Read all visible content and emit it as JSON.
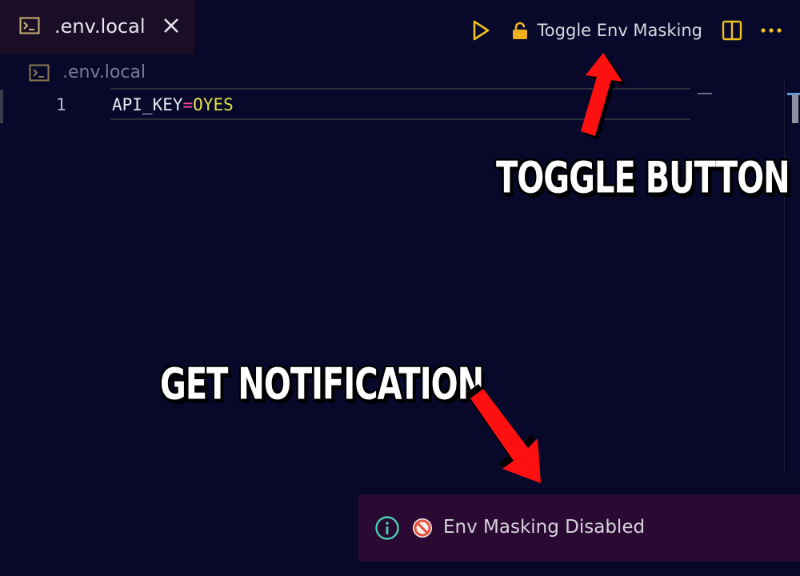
{
  "tab": {
    "title": ".env.local",
    "icon": "terminal-file-icon",
    "close_icon": "close-icon"
  },
  "actions": {
    "run_icon": "play-icon",
    "toggle_icon": "lock-icon",
    "toggle_label": "Toggle Env Masking",
    "split_icon": "split-editor-icon",
    "more_icon": "more-icon"
  },
  "breadcrumb": {
    "icon": "terminal-file-icon",
    "label": ".env.local"
  },
  "editor": {
    "lines": [
      {
        "number": "1",
        "key": "API_KEY",
        "eq": "=",
        "value": "OYES"
      }
    ],
    "colors": {
      "key": "#e8e8f0",
      "equals": "#ff4f9a",
      "value": "#e5e24a",
      "background": "#07082a"
    }
  },
  "annotations": {
    "toggle_caption": "TOGGLE BUTTON",
    "notify_caption": "GET NOTIFICATION",
    "arrow_color": "#ff0000"
  },
  "notification": {
    "info_icon": "info-icon",
    "status_icon": "prohibited-icon",
    "message": "Env Masking Disabled",
    "background": "#2a0a33"
  }
}
